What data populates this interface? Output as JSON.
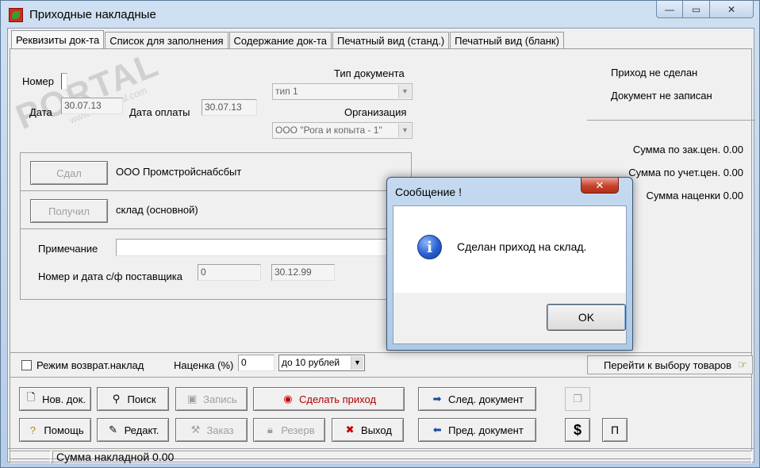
{
  "window": {
    "title": "Приходные накладные",
    "controls": {
      "minimize": "—",
      "maximize": "▭",
      "close": "✕"
    }
  },
  "tabs": [
    {
      "label": "Реквизиты док-та",
      "active": true
    },
    {
      "label": "Список для заполнения"
    },
    {
      "label": "Содержание док-та"
    },
    {
      "label": "Печатный вид (станд.)"
    },
    {
      "label": "Печатный вид (бланк)"
    }
  ],
  "form": {
    "number_label": "Номер",
    "number_value": "",
    "date_label": "Дата",
    "date_value": "30.07.13",
    "pay_date_label": "Дата оплаты",
    "pay_date_value": "30.07.13",
    "doc_type_label": "Тип документа",
    "doc_type_value": "тип 1",
    "org_label": "Организация",
    "org_value": "ООО \"Рога и копыта - 1\"",
    "gave_button": "Сдал",
    "gave_value": "ООО Промстройснабсбыт",
    "received_button": "Получил",
    "received_value": "склад (основной)",
    "note_label": "Примечание",
    "note_value": "",
    "supplier_invoice_label": "Номер и дата с/ф поставщика",
    "supplier_invoice_number": "0",
    "supplier_invoice_date": "30.12.99",
    "return_mode_label": "Режим возврат.наклад",
    "markup_label": "Наценка (%)",
    "markup_value": "0",
    "rounding_value": "до 10 рублей",
    "goto_goods": "Перейти к выбору товаров"
  },
  "status": {
    "receipt_status": "Приход не сделан",
    "doc_status": "Документ не записан",
    "sum_order": "Сумма по зак.цен. 0.00",
    "sum_account": "Сумма по учет.цен. 0.00",
    "sum_markup": "Сумма наценки 0.00"
  },
  "buttons": {
    "new_doc": "Нов. док.",
    "search": "Поиск",
    "save": "Запись",
    "make_receipt": "Сделать приход",
    "next_doc": "След. документ",
    "help": "Помощь",
    "edit": "Редакт.",
    "order": "Заказ",
    "reserve": "Резерв",
    "exit": "Выход",
    "prev_doc": "Пред. документ",
    "dollar": "$",
    "p": "П"
  },
  "statusbar": {
    "sum": "Сумма накладной 0.00"
  },
  "watermark": {
    "text": "PORTAL",
    "sub": "www.softportal.com"
  },
  "dialog": {
    "title": "Сообщение !",
    "close": "✕",
    "message": "Сделан приход на склад.",
    "ok": "OK"
  }
}
